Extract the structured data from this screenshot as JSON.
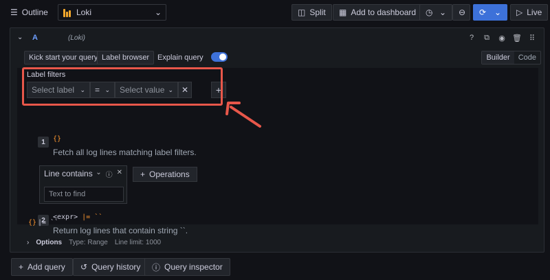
{
  "toolbar": {
    "outline_label": "Outline",
    "datasource_name": "Loki",
    "split_label": "Split",
    "add_dashboard_label": "Add to dashboard",
    "live_label": "Live"
  },
  "query": {
    "letter": "A",
    "datasource": "(Loki)",
    "kick_start_label": "Kick start your query",
    "label_browser_label": "Label browser",
    "explain_label": "Explain query",
    "explain_enabled": true,
    "mode_builder": "Builder",
    "mode_code": "Code",
    "mode_active": "Builder"
  },
  "label_filters": {
    "title": "Label filters",
    "label_placeholder": "Select label",
    "operator": "=",
    "value_placeholder": "Select value"
  },
  "hints": [
    {
      "step": "1",
      "code": "{}",
      "desc": "Fetch all log lines matching label filters."
    },
    {
      "step": "2",
      "code_expr": "<expr>",
      "code_rest": " |= ``",
      "desc": "Return log lines that contain string ``."
    }
  ],
  "operation": {
    "name": "Line contains",
    "placeholder": "Text to find",
    "add_label": "Operations"
  },
  "summary": {
    "braces": "{}",
    "rest": " |= ``"
  },
  "options": {
    "label": "Options",
    "type": "Type: Range",
    "line_limit": "Line limit: 1000"
  },
  "footer": {
    "add_query": "Add query",
    "history": "Query history",
    "inspector": "Query inspector"
  },
  "colors": {
    "accent": "#3d71d9",
    "highlight": "#e8574a",
    "brace": "#ff9830"
  }
}
